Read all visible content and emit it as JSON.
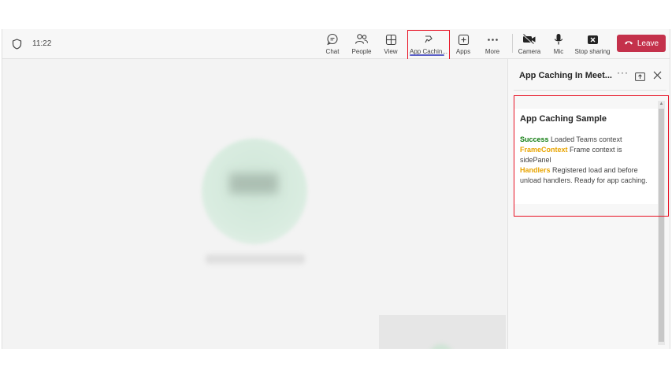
{
  "meeting": {
    "time": "11:22"
  },
  "toolbar": {
    "chat_label": "Chat",
    "people_label": "People",
    "view_label": "View",
    "app_label": "App Cachin...",
    "apps_label": "Apps",
    "more_label": "More",
    "camera_label": "Camera",
    "mic_label": "Mic",
    "share_label": "Stop sharing",
    "leave_label": "Leave"
  },
  "side_panel": {
    "title": "App Caching In Meet...",
    "more_glyph": "···",
    "content": {
      "heading": "App Caching Sample",
      "lines": [
        {
          "key": "Success",
          "text": "Loaded Teams context"
        },
        {
          "key": "FrameContext",
          "text": "Frame context is sidePanel"
        },
        {
          "key": "Handlers",
          "text": "Registered load and before unload handlers. Ready for app caching."
        }
      ]
    },
    "scroll_up_glyph": "▲"
  },
  "colors": {
    "leave": "#c4314b",
    "success": "#107c10",
    "warning": "#e8a400",
    "highlight": "#e81123",
    "accent": "#5b5fc7"
  },
  "icons": [
    "shield-icon",
    "chat-icon",
    "people-icon",
    "view-icon",
    "app-icon",
    "apps-icon",
    "more-icon",
    "camera-icon",
    "mic-icon",
    "share-icon",
    "phone-icon",
    "popout-icon",
    "close-icon"
  ]
}
